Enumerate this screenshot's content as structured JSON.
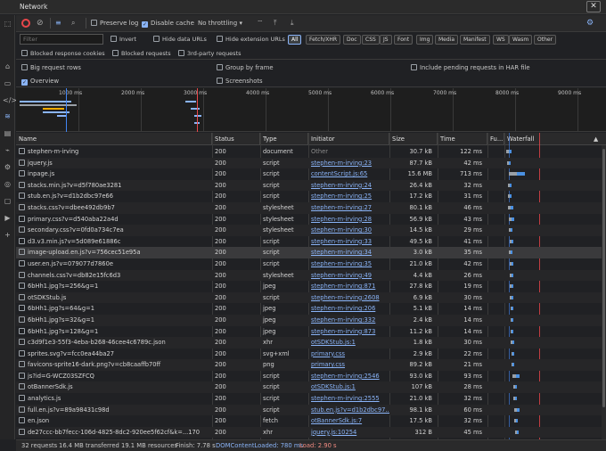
{
  "window": {
    "title": "Network",
    "close": "✕"
  },
  "toolbar": {
    "preserve_log": "Preserve log",
    "disable_cache": "Disable cache",
    "throttling": "No throttling"
  },
  "filter": {
    "placeholder": "Filter",
    "invert": "Invert",
    "hide_data_urls": "Hide data URLs",
    "hide_ext_urls": "Hide extension URLs",
    "types": [
      "All",
      "Fetch/XHR",
      "Doc",
      "CSS",
      "JS",
      "Font",
      "Img",
      "Media",
      "Manifest",
      "WS",
      "Wasm",
      "Other"
    ]
  },
  "row2": {
    "blocked_cookies": "Blocked response cookies",
    "blocked_requests": "Blocked requests",
    "third_party": "3rd-party requests"
  },
  "settings": {
    "big_rows": "Big request rows",
    "group_frame": "Group by frame",
    "include_pending": "Include pending requests in HAR file",
    "overview": "Overview",
    "screenshots": "Screenshots"
  },
  "overview": {
    "ticks": [
      "1000 ms",
      "2000 ms",
      "3000 ms",
      "4000 ms",
      "5000 ms",
      "6000 ms",
      "7000 ms",
      "8000 ms",
      "9000 ms"
    ]
  },
  "table": {
    "headers": {
      "name": "Name",
      "status": "Status",
      "type": "Type",
      "initiator": "Initiator",
      "size": "Size",
      "time": "Time",
      "fu": "Fu...",
      "waterfall": "Waterfall",
      "sort": "▲"
    },
    "rows": [
      {
        "name": "stephen-m-irving",
        "status": "200",
        "type": "document",
        "initiator": "Other",
        "size": "30.7 kB",
        "time": "122 ms"
      },
      {
        "name": "jquery.js",
        "status": "200",
        "type": "script",
        "initiator": "stephen-m-irving:23",
        "size": "87.7 kB",
        "time": "42 ms"
      },
      {
        "name": "inpage.js",
        "status": "200",
        "type": "script",
        "initiator": "contentScript.js:65",
        "size": "15.6 MB",
        "time": "713 ms"
      },
      {
        "name": "stacks.min.js?v=d5f780ae3281",
        "status": "200",
        "type": "script",
        "initiator": "stephen-m-irving:24",
        "size": "26.4 kB",
        "time": "32 ms"
      },
      {
        "name": "stub.en.js?v=d1b2dbc97e66",
        "status": "200",
        "type": "script",
        "initiator": "stephen-m-irving:25",
        "size": "17.2 kB",
        "time": "31 ms"
      },
      {
        "name": "stacks.css?v=dbee492db9b7",
        "status": "200",
        "type": "stylesheet",
        "initiator": "stephen-m-irving:27",
        "size": "80.1 kB",
        "time": "46 ms"
      },
      {
        "name": "primary.css?v=d540aba22a4d",
        "status": "200",
        "type": "stylesheet",
        "initiator": "stephen-m-irving:28",
        "size": "56.9 kB",
        "time": "43 ms"
      },
      {
        "name": "secondary.css?v=0fd0a734c7ea",
        "status": "200",
        "type": "stylesheet",
        "initiator": "stephen-m-irving:30",
        "size": "14.5 kB",
        "time": "29 ms"
      },
      {
        "name": "d3.v3.min.js?v=5d089e61886c",
        "status": "200",
        "type": "script",
        "initiator": "stephen-m-irving:33",
        "size": "49.5 kB",
        "time": "41 ms"
      },
      {
        "name": "image-upload.en.js?v=756cec51e95a",
        "status": "200",
        "type": "script",
        "initiator": "stephen-m-irving:34",
        "size": "3.0 kB",
        "time": "35 ms"
      },
      {
        "name": "user.en.js?v=079077d7860e",
        "status": "200",
        "type": "script",
        "initiator": "stephen-m-irving:35",
        "size": "21.0 kB",
        "time": "42 ms"
      },
      {
        "name": "channels.css?v=db82e15fc6d3",
        "status": "200",
        "type": "stylesheet",
        "initiator": "stephen-m-irving:49",
        "size": "4.4 kB",
        "time": "26 ms"
      },
      {
        "name": "6bHh1.jpg?s=256&g=1",
        "status": "200",
        "type": "jpeg",
        "initiator": "stephen-m-irving:871",
        "size": "27.8 kB",
        "time": "19 ms"
      },
      {
        "name": "otSDKStub.js",
        "status": "200",
        "type": "script",
        "initiator": "stephen-m-irving:2608",
        "size": "6.9 kB",
        "time": "30 ms"
      },
      {
        "name": "6bHh1.jpg?s=64&g=1",
        "status": "200",
        "type": "jpeg",
        "initiator": "stephen-m-irving:206",
        "size": "5.1 kB",
        "time": "14 ms"
      },
      {
        "name": "6bHh1.jpg?s=32&g=1",
        "status": "200",
        "type": "jpeg",
        "initiator": "stephen-m-irving:332",
        "size": "2.4 kB",
        "time": "14 ms"
      },
      {
        "name": "6bHh1.jpg?s=128&g=1",
        "status": "200",
        "type": "jpeg",
        "initiator": "stephen-m-irving:873",
        "size": "11.2 kB",
        "time": "14 ms"
      },
      {
        "name": "c3d9f1e3-55f3-4eba-b268-46cee4c6789c.json",
        "status": "200",
        "type": "xhr",
        "initiator": "otSDKStub.js:1",
        "size": "1.8 kB",
        "time": "30 ms"
      },
      {
        "name": "sprites.svg?v=fcc0ea44ba27",
        "status": "200",
        "type": "svg+xml",
        "initiator": "primary.css",
        "size": "2.9 kB",
        "time": "22 ms"
      },
      {
        "name": "favicons-sprite16-dark.png?v=cb8caaffb70ff",
        "status": "200",
        "type": "png",
        "initiator": "primary.css",
        "size": "89.2 kB",
        "time": "21 ms"
      },
      {
        "name": "js?id=G-WCZ03SZFCQ",
        "status": "200",
        "type": "script",
        "initiator": "stephen-m-irving:2546",
        "size": "93.0 kB",
        "time": "93 ms"
      },
      {
        "name": "otBannerSdk.js",
        "status": "200",
        "type": "script",
        "initiator": "otSDKStub.js:1",
        "size": "107 kB",
        "time": "28 ms"
      },
      {
        "name": "analytics.js",
        "status": "200",
        "type": "script",
        "initiator": "stephen-m-irving:2555",
        "size": "21.0 kB",
        "time": "32 ms"
      },
      {
        "name": "full.en.js?v=89a98431c98d",
        "status": "200",
        "type": "script",
        "initiator": "stub.en.js?v=d1b2dbc97...",
        "size": "98.1 kB",
        "time": "60 ms"
      },
      {
        "name": "en.json",
        "status": "200",
        "type": "fetch",
        "initiator": "otBannerSdk.js:7",
        "size": "17.5 kB",
        "time": "32 ms"
      },
      {
        "name": "de27ccc-bb7fecc-106d-4825-8dc2-920ee5f62cf&k=...170",
        "status": "200",
        "type": "xhr",
        "initiator": "jquery.js:10254",
        "size": "312 B",
        "time": "45 ms"
      }
    ]
  },
  "status": {
    "requests": "32 requests",
    "transferred": "16.4 MB transferred",
    "resources": "19.1 MB resources",
    "finish": "Finish: 7.78 s",
    "dcl": "DOMContentLoaded: 780 ms",
    "load": "Load: 2.90 s"
  },
  "colors": {
    "accent": "#8ab4f8",
    "dcl": "#4285f4",
    "load": "#e8464a"
  }
}
